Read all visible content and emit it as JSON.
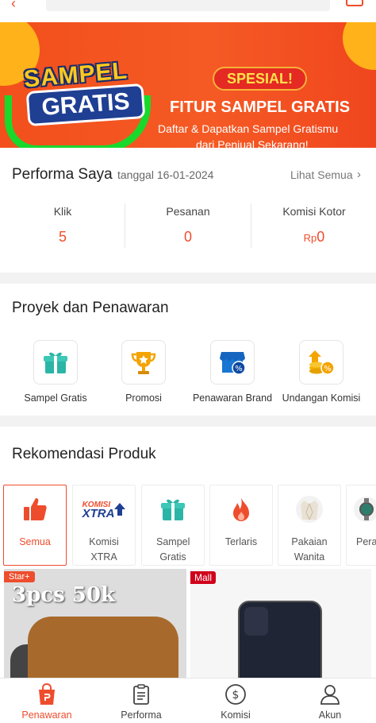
{
  "banner": {
    "logo_top": "SAMPEL",
    "logo_bottom": "GRATIS",
    "badge": "SPESIAL!",
    "headline": "FITUR SAMPEL GRATIS",
    "line1": "Daftar & Dapatkan Sampel Gratismu",
    "line2": "dari Penjual Sekarang!"
  },
  "performance": {
    "title": "Performa Saya",
    "date": "tanggal 16-01-2024",
    "see_all": "Lihat Semua",
    "stats": [
      {
        "label": "Klik",
        "value": "5"
      },
      {
        "label": "Pesanan",
        "value": "0"
      },
      {
        "label": "Komisi Kotor",
        "prefix": "Rp",
        "value": "0"
      }
    ]
  },
  "projects": {
    "title": "Proyek dan Penawaran",
    "items": [
      {
        "label": "Sampel Gratis",
        "icon": "gift-icon"
      },
      {
        "label": "Promosi",
        "icon": "trophy-icon"
      },
      {
        "label": "Penawaran Brand",
        "icon": "store-discount-icon"
      },
      {
        "label": "Undangan Komisi",
        "icon": "coins-discount-icon"
      }
    ]
  },
  "recommendations": {
    "title": "Rekomendasi Produk",
    "chips": [
      {
        "label": "Semua",
        "icon": "thumbs-up-icon",
        "active": true
      },
      {
        "label": "Komisi XTRA",
        "icon": "komisi-xtra-logo"
      },
      {
        "label": "Sampel Gratis",
        "icon": "gift-icon"
      },
      {
        "label": "Terlaris",
        "icon": "fire-icon"
      },
      {
        "label": "Pakaian Wanita",
        "icon": "blazer-icon"
      },
      {
        "label": "Pera & Ke",
        "icon": "watch-icon"
      }
    ],
    "logo_text_1": "KOMISI",
    "logo_text_2": "XTRA"
  },
  "products": [
    {
      "tag": "Star+",
      "image_text": "3pcs 50k"
    },
    {
      "tag": "Mall"
    }
  ],
  "tabbar": [
    {
      "label": "Penawaran",
      "icon": "shopping-bag-icon",
      "active": true
    },
    {
      "label": "Performa",
      "icon": "clipboard-icon"
    },
    {
      "label": "Komisi",
      "icon": "dollar-circle-icon"
    },
    {
      "label": "Akun",
      "icon": "user-icon"
    }
  ],
  "colors": {
    "accent": "#ee4d2d",
    "banner": "#f55a24",
    "badge_text": "#ffe14a"
  }
}
